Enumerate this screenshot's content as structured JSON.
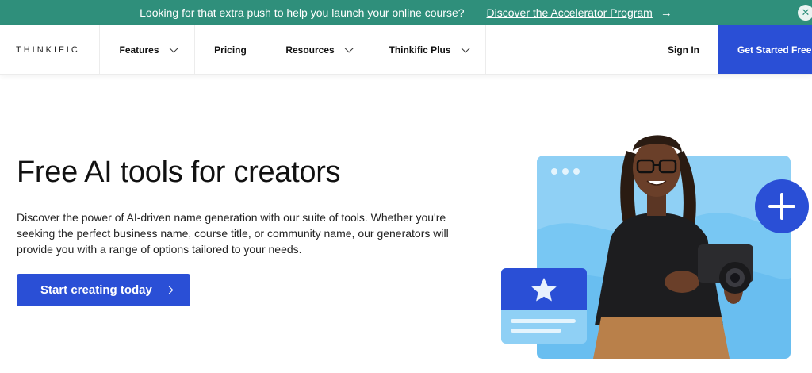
{
  "banner": {
    "message": "Looking for that extra push to help you launch your online course?",
    "link": "Discover the Accelerator Program",
    "arrow_icon": "arrow-right-icon",
    "close_icon": "close-icon"
  },
  "nav": {
    "logo": "THINKIFIC",
    "items": [
      {
        "label": "Features",
        "has_dropdown": true
      },
      {
        "label": "Pricing",
        "has_dropdown": false
      },
      {
        "label": "Resources",
        "has_dropdown": true
      },
      {
        "label": "Thinkific Plus",
        "has_dropdown": true
      }
    ],
    "sign_in": "Sign In",
    "cta": "Get Started Free"
  },
  "hero": {
    "title": "Free AI tools for creators",
    "description": "Discover the power of AI-driven name generation with our suite of tools. Whether you're seeking the perfect business name, course title, or community name, our generators will provide you with a range of options tailored to your needs.",
    "button": "Start creating today"
  },
  "colors": {
    "banner_bg": "#2f8f7b",
    "primary": "#2a4fd6",
    "illus_light": "#8fd0f5",
    "illus_mid": "#5fb8ef"
  }
}
